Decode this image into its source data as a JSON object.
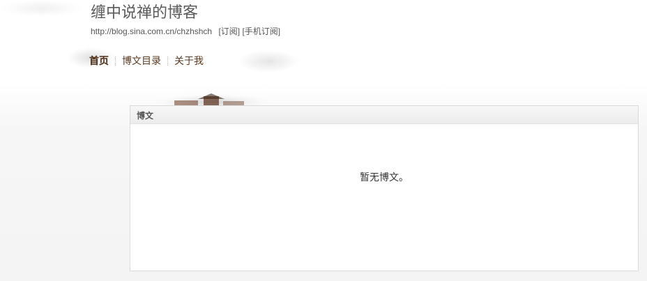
{
  "blog": {
    "title": "缠中说禅的博客",
    "url": "http://blog.sina.com.cn/chzhshch",
    "subscribe_label": "[订阅]",
    "mobile_subscribe_label": "[手机订阅]"
  },
  "nav": {
    "items": [
      {
        "label": "首页",
        "active": true
      },
      {
        "label": "博文目录",
        "active": false
      },
      {
        "label": "关于我",
        "active": false
      }
    ]
  },
  "panel": {
    "title": "博文",
    "empty_message": "暂无博文。"
  }
}
